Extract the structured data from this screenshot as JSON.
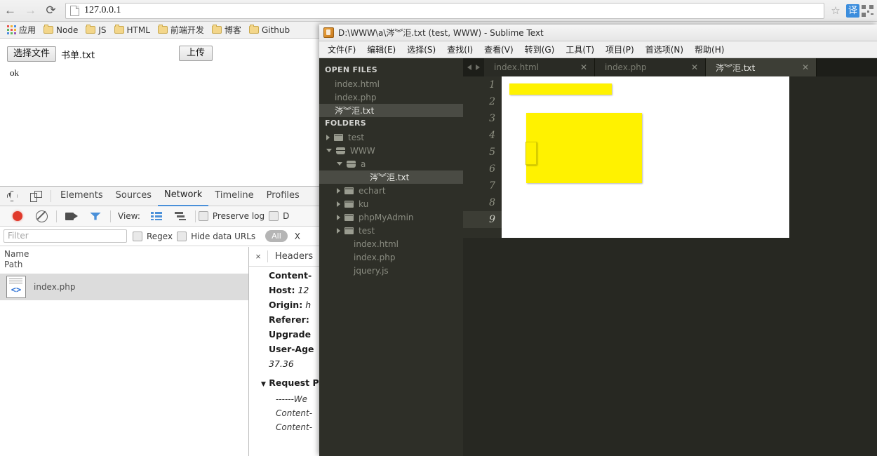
{
  "browser": {
    "url": "127.0.0.1",
    "nav": {
      "back": "←",
      "forward": "→",
      "reload": "⟳"
    },
    "right_icons": {
      "bookmark": "☆",
      "translate": "译"
    },
    "bookmarks": [
      {
        "label": "应用",
        "icon": "apps-grid-icon"
      },
      {
        "label": "Node",
        "icon": "folder-icon"
      },
      {
        "label": "JS",
        "icon": "folder-icon"
      },
      {
        "label": "HTML",
        "icon": "folder-icon"
      },
      {
        "label": "前端开发",
        "icon": "folder-icon"
      },
      {
        "label": "博客",
        "icon": "folder-icon"
      },
      {
        "label": "Github",
        "icon": "folder-icon"
      }
    ],
    "page": {
      "choose_file_label": "选择文件",
      "file_name": "书单.txt",
      "upload_label": "上传",
      "response_text": "ok"
    }
  },
  "devtools": {
    "tabs": [
      {
        "label": "Elements",
        "active": false
      },
      {
        "label": "Sources",
        "active": false
      },
      {
        "label": "Network",
        "active": true
      },
      {
        "label": "Timeline",
        "active": false
      },
      {
        "label": "Profiles",
        "active": false
      }
    ],
    "toolbar": {
      "record_icon": "record-icon",
      "clear_icon": "clear-icon",
      "camera_icon": "camera-icon",
      "filter_icon": "funnel-icon",
      "view_label": "View:",
      "list_view_icon": "list-view-icon",
      "waterfall_view_icon": "waterfall-view-icon",
      "preserve_log_label": "Preserve log",
      "disable_cache_label": "D"
    },
    "filterbar": {
      "filter_placeholder": "Filter",
      "regex_label": "Regex",
      "hide_data_urls_label": "Hide data URLs",
      "type_all_label": "All",
      "type_xhr_label": "X"
    },
    "network": {
      "columns": [
        "Name",
        "Path"
      ],
      "rows": [
        {
          "name": "index.php",
          "icon": "php-file-icon",
          "selected": true
        }
      ]
    },
    "detail": {
      "close_icon": "×",
      "tab_label": "Headers",
      "lines": [
        {
          "key": "Content-",
          "value": ""
        },
        {
          "key": "Host:",
          "value": "12"
        },
        {
          "key": "Origin:",
          "value": "h"
        },
        {
          "key": "Referer:",
          "value": ""
        },
        {
          "key": "Upgrade",
          "value": ""
        },
        {
          "key": "User-Age",
          "value": ""
        }
      ],
      "wrapped_value": "37.36",
      "section_title": "Request Pa",
      "sublines": [
        "------We",
        "Content-",
        "Content-"
      ]
    }
  },
  "sublime": {
    "title": "D:\\WWW\\a\\涔︾洰.txt (test, WWW) - Sublime Text",
    "menu": [
      "文件(F)",
      "编辑(E)",
      "选择(S)",
      "查找(I)",
      "查看(V)",
      "转到(G)",
      "工具(T)",
      "项目(P)",
      "首选项(N)",
      "帮助(H)"
    ],
    "sidebar": {
      "open_files_label": "OPEN FILES",
      "open_files": [
        {
          "label": "index.html",
          "selected": false
        },
        {
          "label": "index.php",
          "selected": false
        },
        {
          "label": "涔︾洰.txt",
          "selected": true
        }
      ],
      "folders_label": "FOLDERS",
      "tree": [
        {
          "label": "test",
          "depth": 0,
          "expanded": false,
          "kind": "folder"
        },
        {
          "label": "WWW",
          "depth": 0,
          "expanded": true,
          "kind": "folder"
        },
        {
          "label": "a",
          "depth": 1,
          "expanded": true,
          "kind": "folder"
        },
        {
          "label": "涔︾洰.txt",
          "depth": 2,
          "kind": "file",
          "selected": true
        },
        {
          "label": "echart",
          "depth": 1,
          "expanded": false,
          "kind": "folder"
        },
        {
          "label": "ku",
          "depth": 1,
          "expanded": false,
          "kind": "folder"
        },
        {
          "label": "phpMyAdmin",
          "depth": 1,
          "expanded": false,
          "kind": "folder"
        },
        {
          "label": "test",
          "depth": 1,
          "expanded": false,
          "kind": "folder"
        },
        {
          "label": "index.html",
          "depth": 1,
          "kind": "file"
        },
        {
          "label": "index.php",
          "depth": 1,
          "kind": "file"
        },
        {
          "label": "jquery.js",
          "depth": 1,
          "kind": "file"
        }
      ]
    },
    "tabs": [
      {
        "label": "index.html",
        "active": false,
        "close": "✕"
      },
      {
        "label": "index.php",
        "active": false,
        "close": "✕"
      },
      {
        "label": "涔︾洰.txt",
        "active": true,
        "close": "✕"
      }
    ],
    "editor": {
      "line_numbers": [
        "1",
        "2",
        "3",
        "4",
        "5",
        "6",
        "7",
        "8",
        "9"
      ],
      "active_line": "9",
      "highlight_color": "#fff200"
    }
  }
}
